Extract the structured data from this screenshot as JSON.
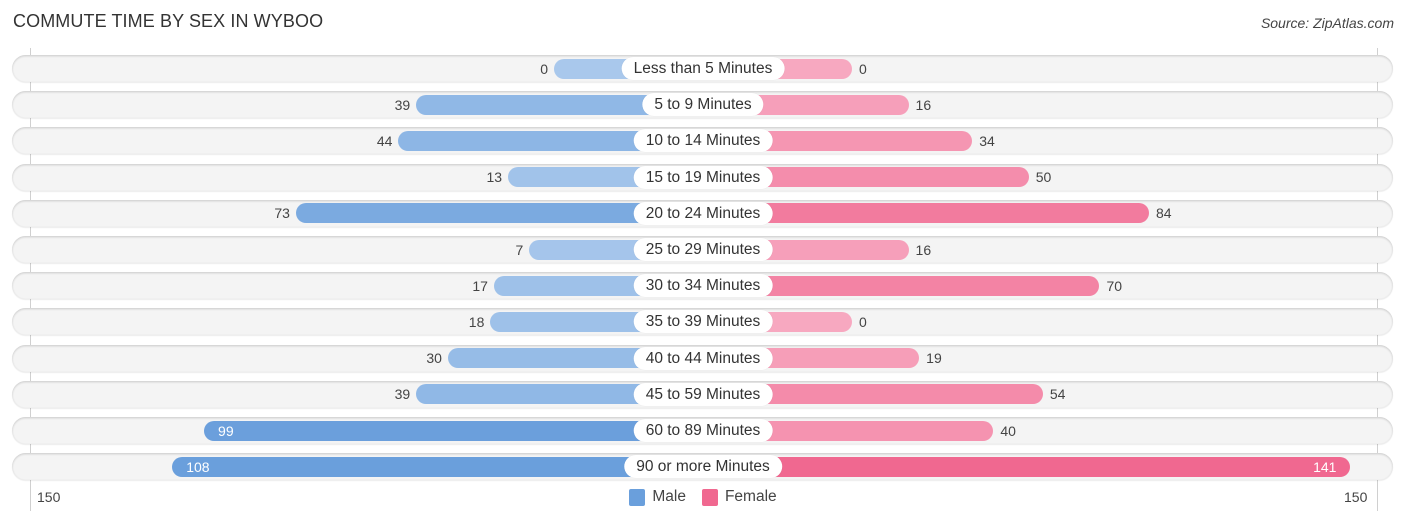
{
  "header": {
    "title": "COMMUTE TIME BY SEX IN WYBOO",
    "source": "Source: ZipAtlas.com"
  },
  "colors": {
    "male": "#6a9fdc",
    "male_light": "#a9c8ec",
    "female": "#f06890",
    "female_light": "#f7a8c0"
  },
  "chart_data": {
    "type": "bar",
    "orientation": "horizontal-diverging",
    "title": "COMMUTE TIME BY SEX IN WYBOO",
    "categories": [
      "Less than 5 Minutes",
      "5 to 9 Minutes",
      "10 to 14 Minutes",
      "15 to 19 Minutes",
      "20 to 24 Minutes",
      "25 to 29 Minutes",
      "30 to 34 Minutes",
      "35 to 39 Minutes",
      "40 to 44 Minutes",
      "45 to 59 Minutes",
      "60 to 89 Minutes",
      "90 or more Minutes"
    ],
    "series": [
      {
        "name": "Male",
        "values": [
          0,
          39,
          44,
          13,
          73,
          7,
          17,
          18,
          30,
          39,
          99,
          108
        ]
      },
      {
        "name": "Female",
        "values": [
          0,
          16,
          34,
          50,
          84,
          16,
          70,
          0,
          19,
          54,
          40,
          141
        ]
      }
    ],
    "axis": {
      "min_label": "150",
      "max_label": "150",
      "range": [
        150,
        150
      ]
    },
    "legend": {
      "position": "bottom-center",
      "entries": [
        "Male",
        "Female"
      ]
    }
  }
}
